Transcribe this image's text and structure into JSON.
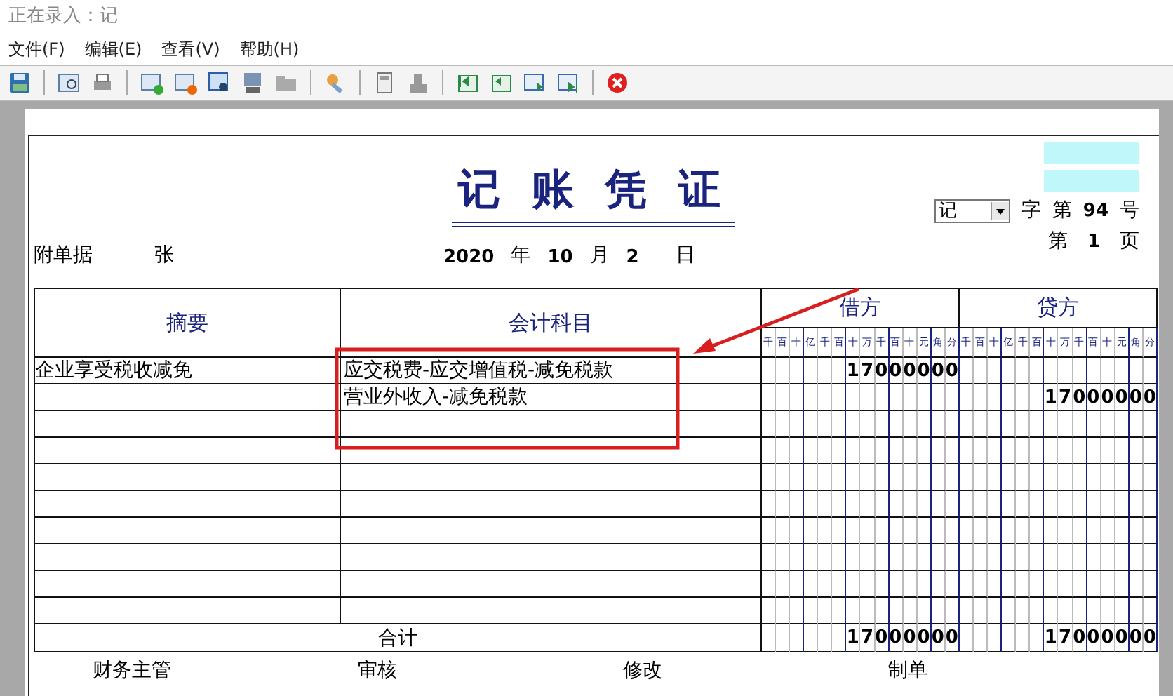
{
  "window": {
    "title": "正在录入：记"
  },
  "menu": [
    {
      "label": "文件(F)"
    },
    {
      "label": "编辑(E)"
    },
    {
      "label": "查看(V)"
    },
    {
      "label": "帮助(H)"
    }
  ],
  "voucher": {
    "title": "记 账 凭 证",
    "type_select": "记",
    "zi": "字",
    "di": "第",
    "number": "94",
    "hao": "号",
    "di_page": "第",
    "page": "1",
    "ye": "页",
    "attachments_label": "附单据",
    "attachments_unit": "张",
    "year": "2020",
    "year_label": "年",
    "month": "10",
    "month_label": "月",
    "day": "2",
    "day_label": "日"
  },
  "table": {
    "summary_heading": "摘要",
    "account_heading": "会计科目",
    "debit_heading": "借方",
    "credit_heading": "贷方",
    "debit_units": [
      "千",
      "百",
      "十",
      "亿",
      "千",
      "百",
      "十",
      "万",
      "千",
      "百",
      "十",
      "元",
      "角",
      "分"
    ],
    "credit_units": [
      "千",
      "百",
      "十",
      "亿",
      "千",
      "百",
      "十",
      "万",
      "千",
      "百",
      "十",
      "元",
      "角",
      "分"
    ],
    "rows": [
      {
        "summary": "企业享受税收减免",
        "account": "应交税费-应交增值税-减免税款",
        "debit": "17000000"
      },
      {
        "account": "营业外收入-减免税款",
        "credit": "17000000"
      }
    ],
    "total": {
      "label": "合计",
      "debit": "17000000",
      "credit": "17000000"
    }
  },
  "footer": [
    {
      "label": "财务主管"
    },
    {
      "label": "审核"
    },
    {
      "label": "修改"
    },
    {
      "label": "制单"
    }
  ]
}
